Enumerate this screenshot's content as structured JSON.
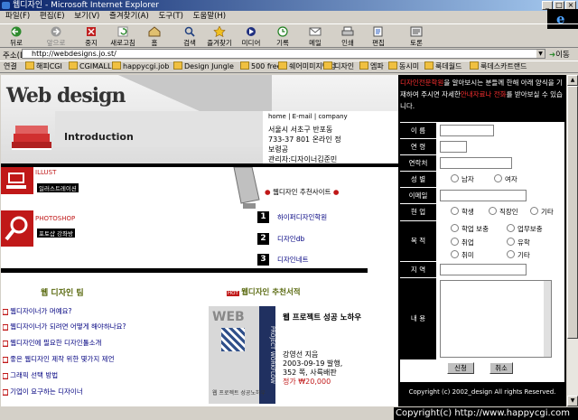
{
  "window": {
    "title": "웹디자인 - Microsoft Internet Explorer"
  },
  "menu": [
    "파일(F)",
    "편집(E)",
    "보기(V)",
    "즐겨찾기(A)",
    "도구(T)",
    "도움말(H)"
  ],
  "toolbar": [
    "뒤로",
    "앞으로",
    "중지",
    "새로고침",
    "홈",
    "검색",
    "즐겨찾기",
    "미디어",
    "기록",
    "메일",
    "인쇄",
    "편집",
    "토론"
  ],
  "address": {
    "label": "주소(D)",
    "url": "http://webdesigns.jo.st/",
    "go": "이동"
  },
  "links": {
    "label": "연결",
    "items": [
      "해피CGI",
      "CGIMALL",
      "happycgi.job",
      "Design Jungle",
      "500 free",
      "쉐어미미지닷컴",
      "디자인",
      "엠파",
      "동시미",
      "룩데월드",
      "룩데스카트랜드"
    ]
  },
  "site": {
    "logo": "Web design",
    "intro": "Introduction",
    "topnav": [
      "home",
      "E-mail",
      "company"
    ],
    "address_lines": [
      "서울시 서초구 반포동",
      "733-37 801 온라인 정",
      "보령공",
      "관리자:디자이너김준민"
    ],
    "left_menu": [
      {
        "title": "ILLUST",
        "sub": "일러스트레이션"
      },
      {
        "title": "PHOTOSHOP",
        "sub": "포토샵 강좌방"
      }
    ],
    "recommend_title": "웹디자인 추천사이트",
    "recommend": [
      {
        "num": "1",
        "label": "하이퍼디자인학원"
      },
      {
        "num": "2",
        "label": "디자인db"
      },
      {
        "num": "3",
        "label": "디자인네트"
      }
    ],
    "tips_title": "웹 디자인 팀",
    "tips": [
      "웹디자이너가 머예요?",
      "웹디자이너가 되려면 어떻게 해야하나요?",
      "웹디자인에 필요한 디자인툴소개",
      "좋은 웹디자인 제작 위한 몇가지 제언",
      "그래픽 선택 방법",
      "기업이 요구하는 디자이너"
    ],
    "book_title": "웹디자인 추천서적",
    "hot": "HOT",
    "book": {
      "cover_top": "WEB",
      "cover_side": "PROJECT WORKFLOW",
      "cover_sub": "웹 프로젝트 성공노하우",
      "name": "웹 프로젝트 성공 노하우",
      "author": "강영선 지음",
      "date": "2003-09-19 발행,",
      "pages": "352 쪽, 사륙배판",
      "price": "정가 ₩20,000"
    }
  },
  "form": {
    "intro_red1": "디자인전문학원",
    "intro_text1": "을 알아보시는 분들께 한해 아래 양식을 기재하여 주시면 자세한",
    "intro_red2": "안내자료나 전화",
    "intro_text2": "를 받아보실 수 있습니다.",
    "labels": [
      "이 름",
      "연 령",
      "연락처",
      "성 별",
      "이메일",
      "현 업",
      "목 적",
      "지 역",
      "내 용"
    ],
    "gender": [
      "남자",
      "여자"
    ],
    "job": [
      "학생",
      "직장인",
      "기타"
    ],
    "purpose": [
      "학업 보충",
      "업무보충",
      "취업",
      "유학",
      "취미",
      "기타"
    ],
    "submit": "신청",
    "cancel": "취소",
    "footer": "Copyright (c) 2002_design All rights Reserved."
  },
  "status": {
    "copyright": "Copyright(c) http://www.happycgi.com"
  }
}
